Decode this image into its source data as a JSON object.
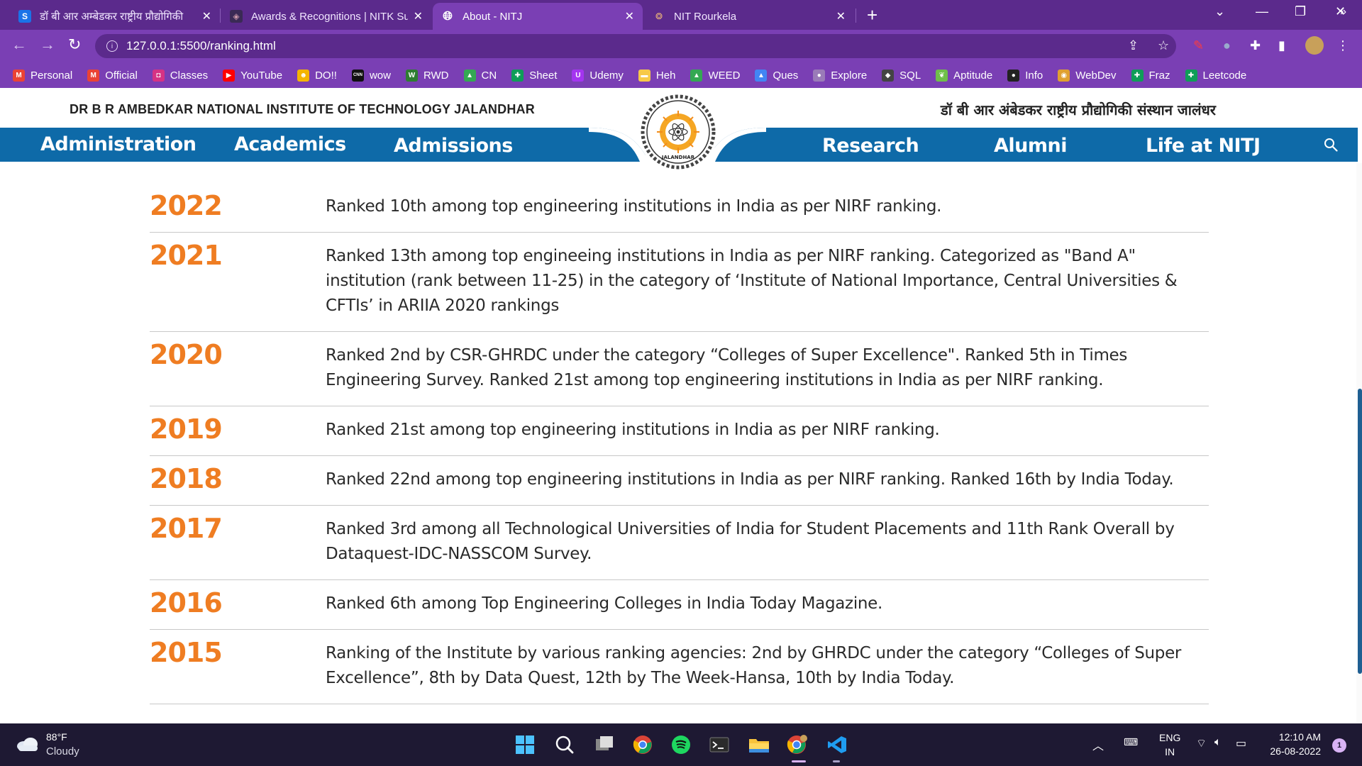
{
  "browser": {
    "tabs": [
      {
        "title": "डॉ बी आर अम्बेडकर राष्ट्रीय प्रौद्योगिकी",
        "favicon": "S",
        "active": false
      },
      {
        "title": "Awards & Recognitions | NITK Su",
        "favicon": "nitk-logo-icon",
        "active": false
      },
      {
        "title": "About - NITJ",
        "favicon": "globe-icon",
        "active": true
      },
      {
        "title": "NIT Rourkela",
        "favicon": "nitr-logo-icon",
        "active": false
      }
    ],
    "url": "127.0.0.1:5500/ranking.html",
    "bookmarks": [
      {
        "label": "Personal",
        "icon": "gmail-icon",
        "color": "#ea4335"
      },
      {
        "label": "Official",
        "icon": "gmail-icon",
        "color": "#ea4335"
      },
      {
        "label": "Classes",
        "icon": "classroom-icon",
        "color": "#d63384"
      },
      {
        "label": "YouTube",
        "icon": "youtube-icon",
        "color": "#ff0000"
      },
      {
        "label": "DO!!",
        "icon": "emoji-icon",
        "color": "#f4b400"
      },
      {
        "label": "wow",
        "icon": "cnn-icon",
        "color": "#111111"
      },
      {
        "label": "RWD",
        "icon": "w-icon",
        "color": "#2e7d32"
      },
      {
        "label": "CN",
        "icon": "drive-icon",
        "color": "#34a853"
      },
      {
        "label": "Sheet",
        "icon": "plus-icon",
        "color": "#0f9d58"
      },
      {
        "label": "Udemy",
        "icon": "udemy-icon",
        "color": "#a435f0"
      },
      {
        "label": "Heh",
        "icon": "folder-icon",
        "color": "#f7c948"
      },
      {
        "label": "WEED",
        "icon": "drive-icon",
        "color": "#34a853"
      },
      {
        "label": "Ques",
        "icon": "drive-icon",
        "color": "#4285f4"
      },
      {
        "label": "Explore",
        "icon": "circle-icon",
        "color": "#9a7bb8"
      },
      {
        "label": "SQL",
        "icon": "sql-icon",
        "color": "#444444"
      },
      {
        "label": "Aptitude",
        "icon": "leaf-icon",
        "color": "#6fbf4a"
      },
      {
        "label": "Info",
        "icon": "github-icon",
        "color": "#222222"
      },
      {
        "label": "WebDev",
        "icon": "webdev-icon",
        "color": "#e0a030"
      },
      {
        "label": "Fraz",
        "icon": "plus-icon",
        "color": "#0f9d58"
      },
      {
        "label": "Leetcode",
        "icon": "plus-icon",
        "color": "#0f9d58"
      }
    ],
    "bookmarks_more": "»"
  },
  "site": {
    "institute_en": "DR B R AMBEDKAR NATIONAL INSTITUTE OF TECHNOLOGY JALANDHAR",
    "institute_hi": "डॉ बी आर अंबेडकर राष्ट्रीय प्रौद्योगिकी संस्थान जालंधर",
    "logo_text": "JALANDHAR",
    "nav_left": [
      "Administration",
      "Academics",
      "Admissions"
    ],
    "nav_right": [
      "Research",
      "Alumni",
      "Life at NITJ"
    ],
    "colors": {
      "nav": "#0e6aa8",
      "year": "#ef7d22"
    }
  },
  "rankings": [
    {
      "year": "2022",
      "text": "Ranked 10th among top engineering institutions in India as per NIRF ranking."
    },
    {
      "year": "2021",
      "text": "Ranked 13th among top engineeing institutions in India as per NIRF ranking. Categorized as \"Band A\" institution (rank between 11-25) in the category of ‘Institute of National Importance, Central Universities & CFTIs’ in ARIIA 2020 rankings"
    },
    {
      "year": "2020",
      "text": "Ranked 2nd by CSR-GHRDC under the category “Colleges of Super Excellence\". Ranked 5th in Times Engineering Survey. Ranked 21st among top engineering institutions in India as per NIRF ranking."
    },
    {
      "year": "2019",
      "text": "Ranked 21st among top engineering institutions in India as per NIRF ranking."
    },
    {
      "year": "2018",
      "text": "Ranked 22nd among top engineering institutions in India as per NIRF ranking. Ranked 16th by India Today."
    },
    {
      "year": "2017",
      "text": "Ranked 3rd among all Technological Universities of India for Student Placements and 11th Rank Overall by Dataquest-IDC-NASSCOM Survey."
    },
    {
      "year": "2016",
      "text": "Ranked 6th among Top Engineering Colleges in India Today Magazine."
    },
    {
      "year": "2015",
      "text": "Ranking of the Institute by various ranking agencies: 2nd by GHRDC under the category “Colleges of Super Excellence”, 8th by Data Quest, 12th by The Week-Hansa, 10th by India Today."
    }
  ],
  "taskbar": {
    "weather_temp": "88°F",
    "weather_cond": "Cloudy",
    "lang_top": "ENG",
    "lang_bottom": "IN",
    "time": "12:10 AM",
    "date": "26-08-2022",
    "notification_count": "1"
  }
}
